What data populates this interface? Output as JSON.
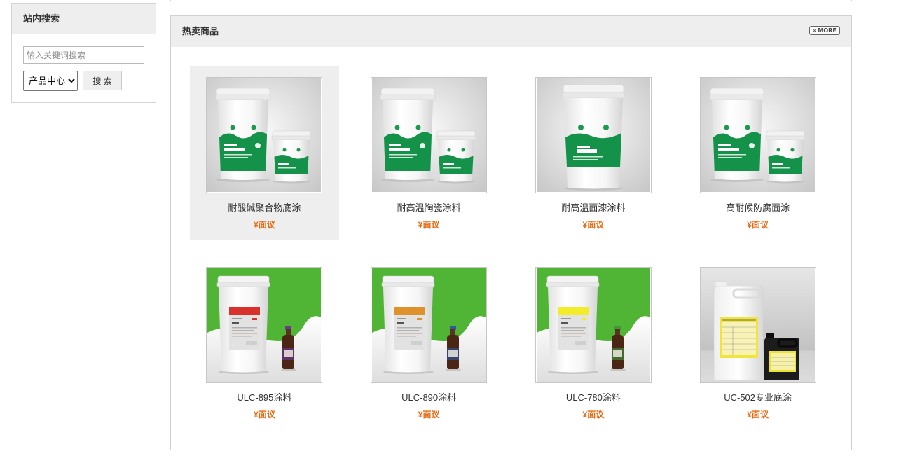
{
  "sidebar": {
    "title": "站内搜索",
    "search": {
      "placeholder": "输入关键词搜索",
      "category_selected": "产品中心",
      "button_label": "搜 索"
    }
  },
  "hot_products": {
    "title": "热卖商品",
    "more_icon": "double-chevron-right-icon",
    "more_label": "MORE",
    "items": [
      {
        "name": "耐酸碱聚合物底涂",
        "price": "¥面议",
        "highlighted": true
      },
      {
        "name": "耐高温陶瓷涂料",
        "price": "¥面议"
      },
      {
        "name": "耐高温面漆涂料",
        "price": "¥面议"
      },
      {
        "name": "高耐候防腐面涂",
        "price": "¥面议"
      },
      {
        "name": "ULC-895涂料",
        "price": "¥面议"
      },
      {
        "name": "ULC-890涂料",
        "price": "¥面议"
      },
      {
        "name": "ULC-780涂料",
        "price": "¥面议"
      },
      {
        "name": "UC-502专业底涂",
        "price": "¥面议"
      }
    ]
  },
  "colors": {
    "price": "#e8690f",
    "panel_header_bg": "#eeeeee",
    "hovered_card_bg": "#eeeeee"
  }
}
